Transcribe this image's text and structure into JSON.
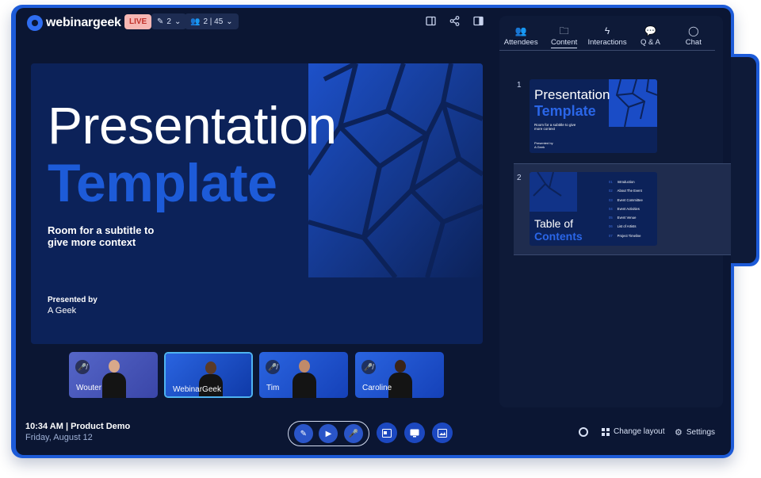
{
  "app": {
    "logo_text": "webinargeek",
    "live_label": "LIVE",
    "presenters_count": "2",
    "attendees_count": "2 | 45"
  },
  "colors": {
    "frame": "#1d5bd8",
    "background": "#0b1633",
    "panel": "#0e1a38",
    "accent": "#1d5bd8",
    "live_badge": "#f6b7b4"
  },
  "slide": {
    "title_line1": "Presentation",
    "title_line2": "Template",
    "subtitle_line1": "Room for a subtitle to",
    "subtitle_line2": "give more context",
    "presented_by_label": "Presented by",
    "presenter_name": "A Geek"
  },
  "participants": [
    {
      "name": "Wouter",
      "muted": true,
      "active": false
    },
    {
      "name": "WebinarGeek",
      "muted": false,
      "active": true
    },
    {
      "name": "Tim",
      "muted": true,
      "active": false
    },
    {
      "name": "Caroline",
      "muted": true,
      "active": false
    }
  ],
  "footer": {
    "time": "10:34 AM",
    "session_title": "Product Demo",
    "date": "Friday, August 12",
    "change_layout_label": "Change layout",
    "settings_label": "Settings"
  },
  "panel": {
    "tabs": [
      {
        "label": "Attendees",
        "icon": "people-icon",
        "active": false
      },
      {
        "label": "Content",
        "icon": "folder-icon",
        "active": true
      },
      {
        "label": "Interactions",
        "icon": "lightning-icon",
        "active": false
      },
      {
        "label": "Q & A",
        "icon": "question-icon",
        "active": false
      },
      {
        "label": "Chat",
        "icon": "chat-icon",
        "active": false
      }
    ],
    "slides": [
      {
        "number": "1",
        "title_line1": "Presentation",
        "title_line2": "Template",
        "subtitle": "Room for a subtitle to give more context",
        "presented_by": "Presented by",
        "presenter": "A Geek"
      },
      {
        "number": "2",
        "title_line1": "Table of",
        "title_line2": "Contents",
        "items": [
          {
            "n": "01",
            "label": "Introduction"
          },
          {
            "n": "02",
            "label": "About The Event"
          },
          {
            "n": "03",
            "label": "Event Committee"
          },
          {
            "n": "04",
            "label": "Event Activities"
          },
          {
            "n": "05",
            "label": "Event Venue"
          },
          {
            "n": "06",
            "label": "List of Artists"
          },
          {
            "n": "07",
            "label": "Project Timeline"
          }
        ]
      }
    ]
  }
}
